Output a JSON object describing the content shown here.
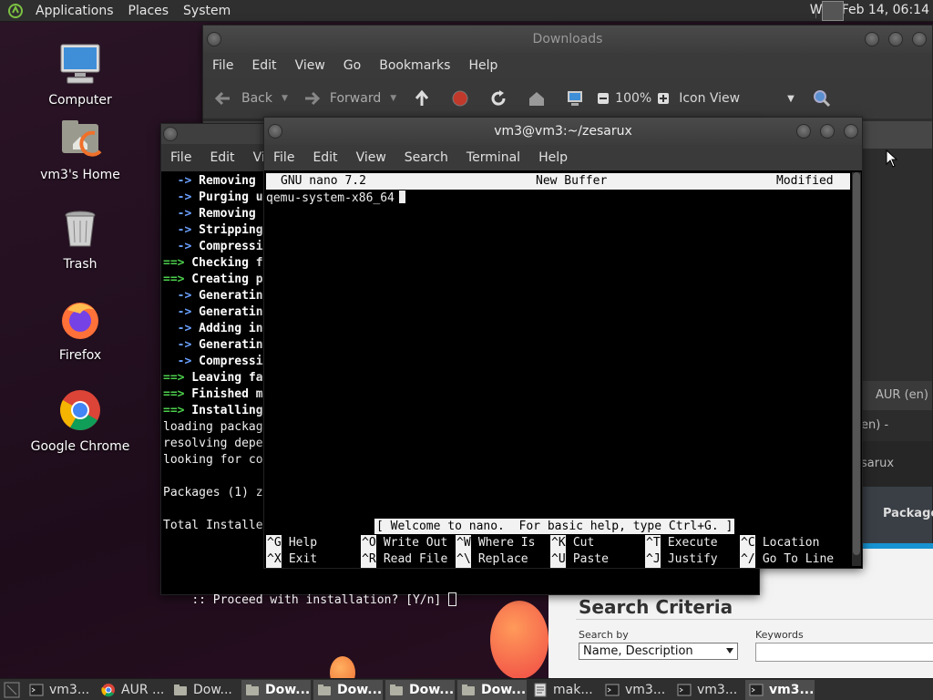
{
  "top_panel": {
    "menus": [
      "Applications",
      "Places",
      "System"
    ],
    "clock": "Wed Feb 14, 06:14"
  },
  "desktop_icons": [
    {
      "label": "Computer",
      "icon": "computer-icon"
    },
    {
      "label": "vm3's Home",
      "icon": "home-folder-icon"
    },
    {
      "label": "Trash",
      "icon": "trash-icon"
    },
    {
      "label": "Firefox",
      "icon": "firefox-icon"
    },
    {
      "label": "Google Chrome",
      "icon": "chrome-icon"
    }
  ],
  "downloads_window": {
    "title": "Downloads",
    "menus": [
      "File",
      "Edit",
      "View",
      "Go",
      "Bookmarks",
      "Help"
    ],
    "toolbar": {
      "back": "Back",
      "forward": "Forward",
      "zoom": "100%",
      "view_mode": "Icon View"
    }
  },
  "browser_fragments": {
    "tab": "AUR (en) -",
    "line1": "en) - zesarux",
    "line2": "sarux",
    "packages": "Packages"
  },
  "aur_page": {
    "search_criteria": "Search Criteria",
    "search_by_label": "Search by",
    "search_by_value": "Name, Description",
    "keywords_label": "Keywords"
  },
  "back_terminal": {
    "menus": [
      "File",
      "Edit",
      "View"
    ],
    "lines": [
      {
        "prefix": "  ->",
        "prefix_class": "arrow-blue",
        "text": " Removing",
        "bold": true
      },
      {
        "prefix": "  ->",
        "prefix_class": "arrow-blue",
        "text": " Purging u",
        "bold": true
      },
      {
        "prefix": "  ->",
        "prefix_class": "arrow-blue",
        "text": " Removing",
        "bold": true
      },
      {
        "prefix": "  ->",
        "prefix_class": "arrow-blue",
        "text": " Stripping",
        "bold": true
      },
      {
        "prefix": "  ->",
        "prefix_class": "arrow-blue",
        "text": " Compressi",
        "bold": true
      },
      {
        "prefix": "==>",
        "prefix_class": "arrow-green",
        "text": " Checking f",
        "bold": true
      },
      {
        "prefix": "==>",
        "prefix_class": "arrow-green",
        "text": " Creating p",
        "bold": true
      },
      {
        "prefix": "  ->",
        "prefix_class": "arrow-blue",
        "text": " Generatin",
        "bold": true
      },
      {
        "prefix": "  ->",
        "prefix_class": "arrow-blue",
        "text": " Generatin",
        "bold": true
      },
      {
        "prefix": "  ->",
        "prefix_class": "arrow-blue",
        "text": " Adding in",
        "bold": true
      },
      {
        "prefix": "  ->",
        "prefix_class": "arrow-blue",
        "text": " Generatin",
        "bold": true
      },
      {
        "prefix": "  ->",
        "prefix_class": "arrow-blue",
        "text": " Compressi",
        "bold": true
      },
      {
        "prefix": "==>",
        "prefix_class": "arrow-green",
        "text": " Leaving fa",
        "bold": true
      },
      {
        "prefix": "==>",
        "prefix_class": "arrow-green",
        "text": " Finished m",
        "bold": true
      },
      {
        "prefix": "==>",
        "prefix_class": "arrow-green",
        "text": " Installing",
        "bold": true
      },
      {
        "prefix": "",
        "prefix_class": "",
        "text": "loading packag",
        "bold": false
      },
      {
        "prefix": "",
        "prefix_class": "",
        "text": "resolving depe",
        "bold": false
      },
      {
        "prefix": "",
        "prefix_class": "",
        "text": "looking for co",
        "bold": false
      },
      {
        "prefix": "",
        "prefix_class": "",
        "text": "",
        "bold": false
      },
      {
        "prefix": "",
        "prefix_class": "",
        "text": "Packages (1) z",
        "bold": false
      },
      {
        "prefix": "",
        "prefix_class": "",
        "text": "",
        "bold": false
      },
      {
        "prefix": "",
        "prefix_class": "",
        "text": "Total Installe",
        "bold": false
      },
      {
        "prefix": "",
        "prefix_class": "",
        "text": "",
        "bold": false
      }
    ],
    "prompt": ":: Proceed with installation? [Y/n] "
  },
  "front_terminal": {
    "title": "vm3@vm3:~/zesarux",
    "menus": [
      "File",
      "Edit",
      "View",
      "Search",
      "Terminal",
      "Help"
    ],
    "nano_version": "GNU nano 7.2",
    "buffer_name": "New Buffer",
    "buffer_state": "Modified",
    "buffer_text": "qemu-system-x86_64",
    "status_message": "[ Welcome to nano.  For basic help, type Ctrl+G. ]",
    "shortcuts": [
      [
        {
          "key": "^G",
          "label": "Help"
        },
        {
          "key": "^X",
          "label": "Exit"
        }
      ],
      [
        {
          "key": "^O",
          "label": "Write Out"
        },
        {
          "key": "^R",
          "label": "Read File"
        }
      ],
      [
        {
          "key": "^W",
          "label": "Where Is"
        },
        {
          "key": "^\\",
          "label": "Replace"
        }
      ],
      [
        {
          "key": "^K",
          "label": "Cut"
        },
        {
          "key": "^U",
          "label": "Paste"
        }
      ],
      [
        {
          "key": "^T",
          "label": "Execute"
        },
        {
          "key": "^J",
          "label": "Justify"
        }
      ],
      [
        {
          "key": "^C",
          "label": "Location"
        },
        {
          "key": "^/",
          "label": "Go To Line"
        }
      ]
    ]
  },
  "taskbar": {
    "tasks": [
      {
        "label": "vm3...",
        "icon": "terminal-icon",
        "active": false
      },
      {
        "label": "AUR ...",
        "icon": "chrome-icon",
        "active": false
      },
      {
        "label": "Dow...",
        "icon": "folder-icon",
        "active": false
      },
      {
        "label": "Dow...",
        "icon": "folder-icon",
        "active": true
      },
      {
        "label": "Dow...",
        "icon": "folder-icon",
        "active": true
      },
      {
        "label": "Dow...",
        "icon": "folder-icon",
        "active": true
      },
      {
        "label": "Dow...",
        "icon": "folder-icon",
        "active": true
      },
      {
        "label": "mak...",
        "icon": "script-icon",
        "active": false
      },
      {
        "label": "vm3...",
        "icon": "terminal-icon",
        "active": false
      },
      {
        "label": "vm3...",
        "icon": "terminal-icon",
        "active": false
      },
      {
        "label": "vm3...",
        "icon": "terminal-icon",
        "active": true
      }
    ]
  },
  "colors": {
    "nano_bar": "#f2f2f2",
    "arrow_blue": "#6aa0ff",
    "arrow_green": "#4cd04c",
    "aur_blue": "#1793d1"
  }
}
